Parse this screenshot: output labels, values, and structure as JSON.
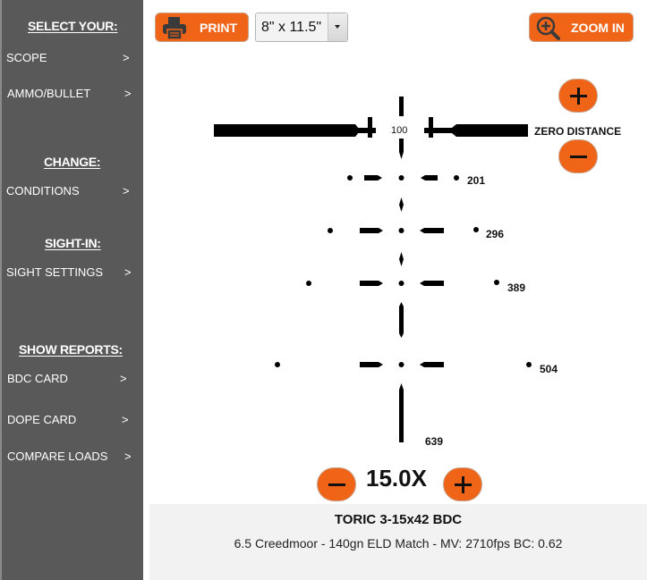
{
  "sidebar": {
    "sections": [
      {
        "heading": "SELECT YOUR:",
        "items": [
          {
            "label": "SCOPE",
            "arrow": ">"
          },
          {
            "label": "AMMO/BULLET",
            "arrow": ">"
          }
        ]
      },
      {
        "heading": "CHANGE:",
        "items": [
          {
            "label": "CONDITIONS",
            "arrow": ">"
          }
        ]
      },
      {
        "heading": "SIGHT-IN:",
        "items": [
          {
            "label": "SIGHT SETTINGS",
            "arrow": ">"
          }
        ]
      },
      {
        "heading": "SHOW REPORTS:",
        "items": [
          {
            "label": "BDC CARD",
            "arrow": ">"
          },
          {
            "label": "DOPE CARD",
            "arrow": ">"
          },
          {
            "label": "COMPARE LOADS",
            "arrow": ">"
          }
        ]
      }
    ]
  },
  "toolbar": {
    "print_label": "PRINT",
    "print_icon": "printer-icon",
    "paper_size": "8\" x 11.5\"",
    "zoom_label": "ZOOM IN",
    "zoom_icon": "zoom-in-icon"
  },
  "reticle": {
    "zero_distance": "100",
    "holdover_labels": [
      "201",
      "296",
      "389",
      "504",
      "639"
    ],
    "zero_distance_label": "ZERO DISTANCE"
  },
  "magnification": "15.0X",
  "scope_info": {
    "name": "TORIC 3-15x42 BDC",
    "load": "6.5 Creedmoor - 140gn ELD Match - MV: 2710fps BC: 0.62"
  },
  "colors": {
    "accent": "#f06418",
    "sidebar": "#595959",
    "info_panel": "#f2f2f2"
  }
}
